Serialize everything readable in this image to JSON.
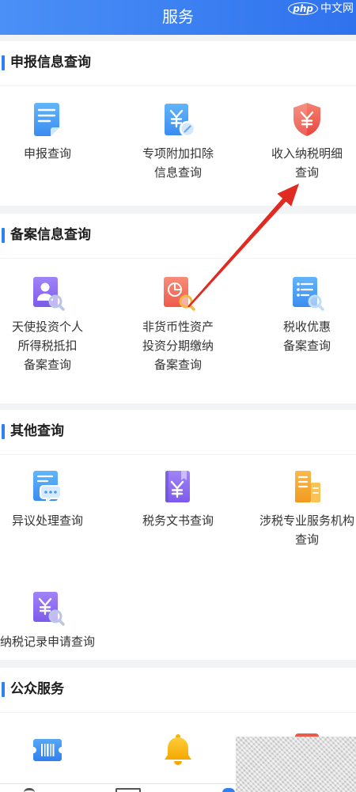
{
  "header": {
    "title": "服务"
  },
  "watermark": {
    "logo": "php",
    "text": "中文网"
  },
  "sections": [
    {
      "title": "申报信息查询",
      "items": [
        {
          "icon": "document-icon",
          "lines": [
            "申报查询"
          ]
        },
        {
          "icon": "special-deduction-icon",
          "lines": [
            "专项附加扣除",
            "信息查询"
          ]
        },
        {
          "icon": "income-tax-shield-icon",
          "lines": [
            "收入纳税明细",
            "查询"
          ]
        }
      ]
    },
    {
      "title": "备案信息查询",
      "items": [
        {
          "icon": "person-search-icon",
          "lines": [
            "天使投资个人",
            "所得税抵扣",
            "备案查询"
          ]
        },
        {
          "icon": "pie-chart-search-icon",
          "lines": [
            "非货币性资产",
            "投资分期缴纳",
            "备案查询"
          ]
        },
        {
          "icon": "list-search-icon",
          "lines": [
            "税收优惠",
            "备案查询"
          ]
        }
      ]
    },
    {
      "title": "其他查询",
      "items": [
        {
          "icon": "chat-document-icon",
          "lines": [
            "异议处理查询"
          ]
        },
        {
          "icon": "yen-book-icon",
          "lines": [
            "税务文书查询"
          ]
        },
        {
          "icon": "building-icon",
          "lines": [
            "涉税专业服务机构",
            "查询"
          ]
        },
        {
          "icon": "yen-search-icon",
          "lines": [
            "纳税记录申请查询"
          ]
        }
      ]
    },
    {
      "title": "公众服务",
      "items": [
        {
          "icon": "ticket-barcode-icon"
        },
        {
          "icon": "bell-icon"
        },
        {
          "icon": "red-service-icon"
        }
      ]
    }
  ],
  "colors": {
    "header_start": "#4a90f6",
    "header_end": "#2f72ee",
    "accent_bar": "#2f80f5",
    "page_bg": "#f2f3f5",
    "annotation_arrow": "#e02a22"
  }
}
